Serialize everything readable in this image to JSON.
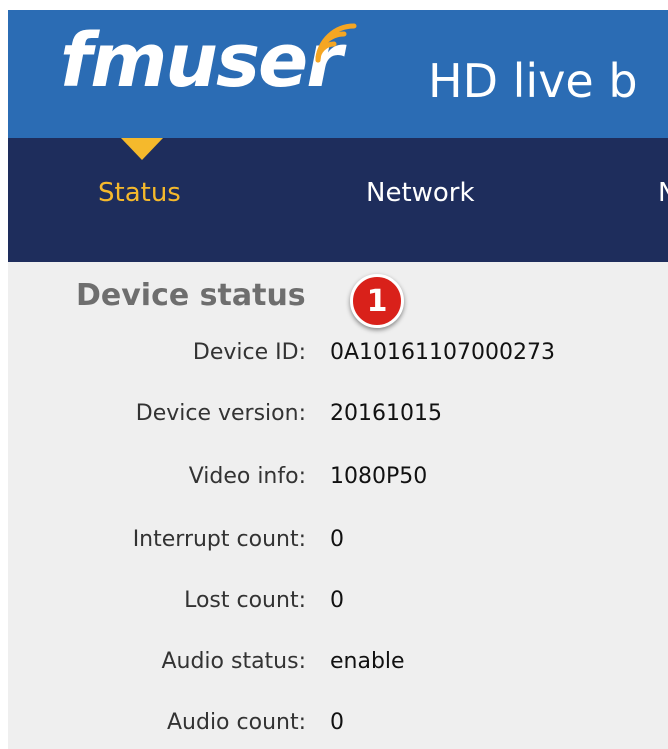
{
  "header": {
    "logo_text": "fmuser",
    "title": "HD live b"
  },
  "nav": {
    "items": [
      {
        "label": "Status",
        "active": true
      },
      {
        "label": "Network",
        "active": false
      },
      {
        "label": "N",
        "active": false
      }
    ]
  },
  "device_status": {
    "title": "Device status",
    "badge": "1",
    "rows": [
      {
        "label": "Device ID:",
        "value": "0A10161107000273"
      },
      {
        "label": "Device version:",
        "value": "20161015"
      },
      {
        "label": "Video info:",
        "value": "1080P50"
      },
      {
        "label": "Interrupt count:",
        "value": "0"
      },
      {
        "label": "Lost count:",
        "value": "0"
      },
      {
        "label": "Audio status:",
        "value": "enable"
      },
      {
        "label": "Audio count:",
        "value": "0"
      }
    ]
  },
  "colors": {
    "banner": "#2b6cb4",
    "navbar": "#1e2d5c",
    "active_nav": "#f5b92c",
    "logo_wifi": "#f5a623",
    "badge": "#d9211a",
    "content_bg": "#efefef"
  }
}
